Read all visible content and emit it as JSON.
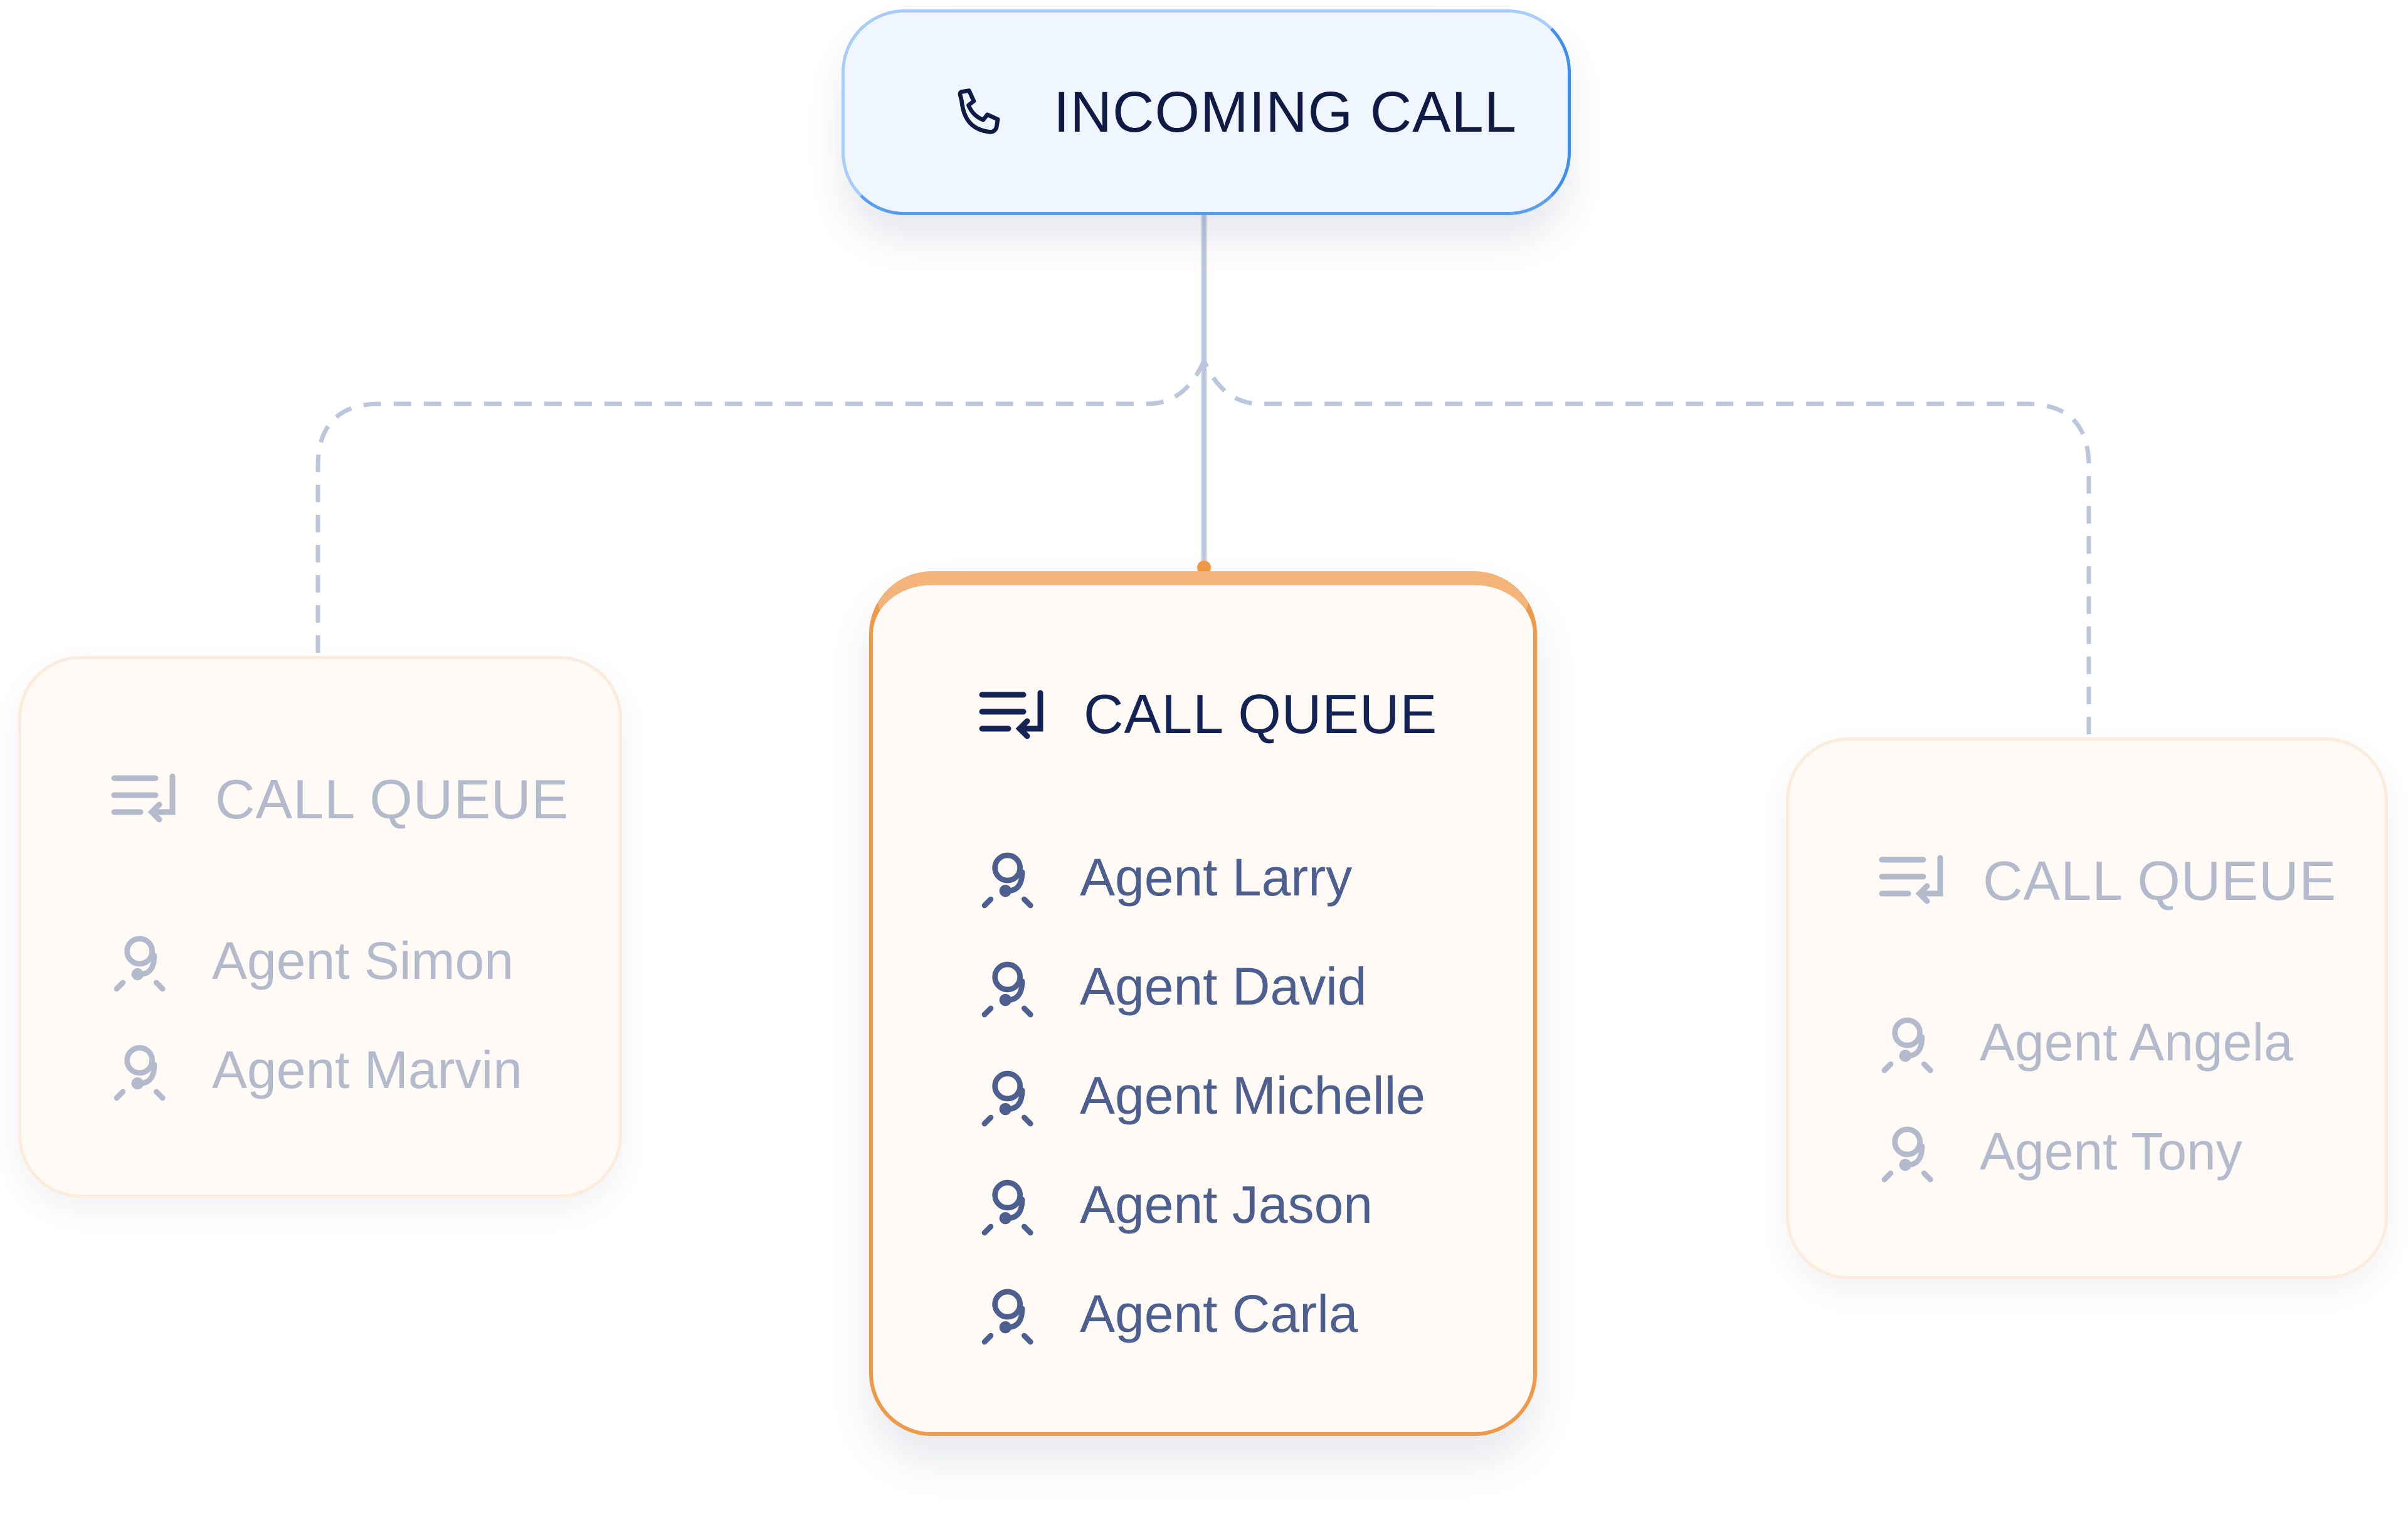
{
  "incoming": {
    "label": "INCOMING CALL",
    "icon": "phone-icon"
  },
  "queues": [
    {
      "title": "CALL QUEUE",
      "icon": "queue-icon",
      "state": "inactive",
      "agents": [
        "Agent Simon",
        "Agent Marvin"
      ]
    },
    {
      "title": "CALL QUEUE",
      "icon": "queue-icon",
      "state": "active",
      "agents": [
        "Agent Larry",
        "Agent David",
        "Agent Michelle",
        "Agent Jason",
        "Agent Carla"
      ]
    },
    {
      "title": "CALL QUEUE",
      "icon": "queue-icon",
      "state": "inactive",
      "agents": [
        "Agent Angela",
        "Agent Tony"
      ]
    }
  ],
  "colors": {
    "active_border": "#ef9a48",
    "incoming_border": "#3f8ef0",
    "connector": "#bcc6de",
    "text_dark": "#142356"
  }
}
